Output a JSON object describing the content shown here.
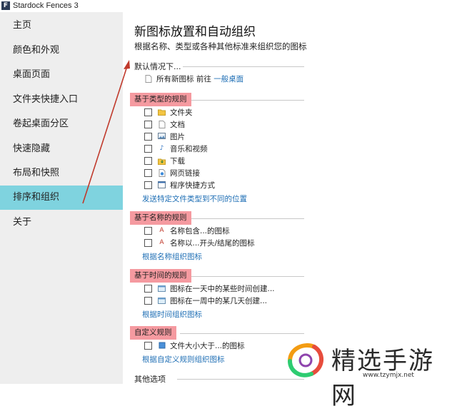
{
  "window": {
    "title": "Stardock Fences 3",
    "icon_letter": "F"
  },
  "sidebar": {
    "items": [
      {
        "label": "主页"
      },
      {
        "label": "颜色和外观"
      },
      {
        "label": "桌面页面"
      },
      {
        "label": "文件夹快捷入口"
      },
      {
        "label": "卷起桌面分区"
      },
      {
        "label": "快速隐藏"
      },
      {
        "label": "布局和快照"
      },
      {
        "label": "排序和组织",
        "active": true
      },
      {
        "label": "关于"
      }
    ]
  },
  "main": {
    "title": "新图标放置和自动组织",
    "subtitle": "根据名称、类型或各种其他标准来组织您的图标",
    "default_section": {
      "label": "默认情况下...",
      "row_text": "所有新图标 前往",
      "row_link": "一般桌面"
    },
    "type_rules": {
      "label": "基于类型的规则",
      "items": [
        {
          "label": "文件夹",
          "icon": "folder-icon"
        },
        {
          "label": "文档",
          "icon": "document-icon"
        },
        {
          "label": "图片",
          "icon": "image-icon"
        },
        {
          "label": "音乐和视频",
          "icon": "music-icon"
        },
        {
          "label": "下载",
          "icon": "download-icon"
        },
        {
          "label": "网页链接",
          "icon": "web-link-icon"
        },
        {
          "label": "程序快捷方式",
          "icon": "program-icon"
        }
      ],
      "link": "发送特定文件类型到不同的位置"
    },
    "name_rules": {
      "label": "基于名称的规则",
      "items": [
        {
          "label": "名称包含...的图标",
          "icon": "name-rule-icon"
        },
        {
          "label": "名称以...开头/结尾的图标",
          "icon": "name-rule-icon"
        }
      ],
      "link": "根据名称组织图标"
    },
    "time_rules": {
      "label": "基于时间的规则",
      "items": [
        {
          "label": "图标在一天中的某些时间创建...",
          "icon": "time-rule-icon"
        },
        {
          "label": "图标在一周中的某几天创建...",
          "icon": "time-rule-icon"
        }
      ],
      "link": "根据时间组织图标"
    },
    "custom_rules": {
      "label": "自定义规则",
      "items": [
        {
          "label": "文件大小大于...的图标",
          "icon": "size-rule-icon"
        }
      ],
      "link": "根据自定义规则组织图标"
    },
    "other_options": {
      "label": "其他选项"
    }
  },
  "watermark": {
    "text": "精选手游网",
    "url": "www.tzymjx.net"
  },
  "colors": {
    "active_nav": "#7fd3df",
    "highlight": "#f59aa0",
    "link": "#1f6fb5",
    "arrow": "#c0392b"
  }
}
